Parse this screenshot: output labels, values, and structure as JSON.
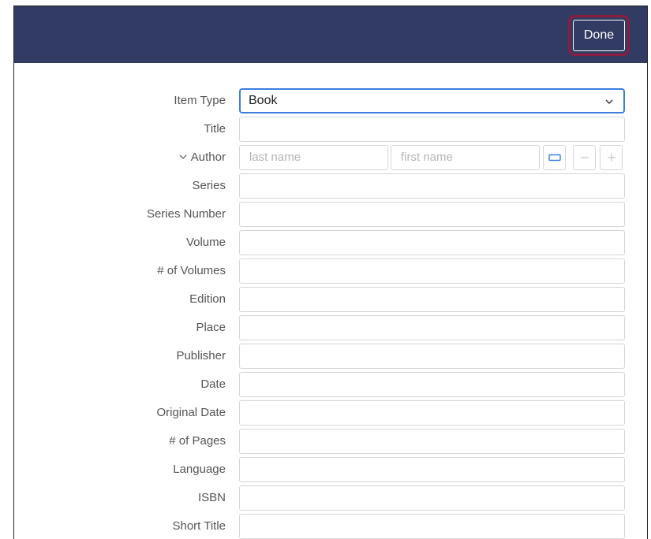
{
  "header": {
    "done_label": "Done"
  },
  "form": {
    "item_type": {
      "label": "Item Type",
      "value": "Book"
    },
    "title": {
      "label": "Title",
      "value": ""
    },
    "author": {
      "label": "Author",
      "last_name_placeholder": "last name",
      "first_name_placeholder": "first name"
    },
    "fields": [
      {
        "label": "Series",
        "value": ""
      },
      {
        "label": "Series Number",
        "value": ""
      },
      {
        "label": "Volume",
        "value": ""
      },
      {
        "label": "# of Volumes",
        "value": ""
      },
      {
        "label": "Edition",
        "value": ""
      },
      {
        "label": "Place",
        "value": ""
      },
      {
        "label": "Publisher",
        "value": ""
      },
      {
        "label": "Date",
        "value": ""
      },
      {
        "label": "Original Date",
        "value": ""
      },
      {
        "label": "# of Pages",
        "value": ""
      },
      {
        "label": "Language",
        "value": ""
      },
      {
        "label": "ISBN",
        "value": ""
      },
      {
        "label": "Short Title",
        "value": ""
      }
    ]
  },
  "icons": {
    "item_type_caret": "chevron-down-icon",
    "author_toggle": "chevron-down-icon",
    "switch_name_mode": "single-field-icon",
    "remove_author": "minus-icon",
    "add_author": "plus-icon"
  },
  "colors": {
    "header_bg": "#323b63",
    "done_highlight": "#8b1e3f",
    "focus_border": "#3b7ddd"
  }
}
